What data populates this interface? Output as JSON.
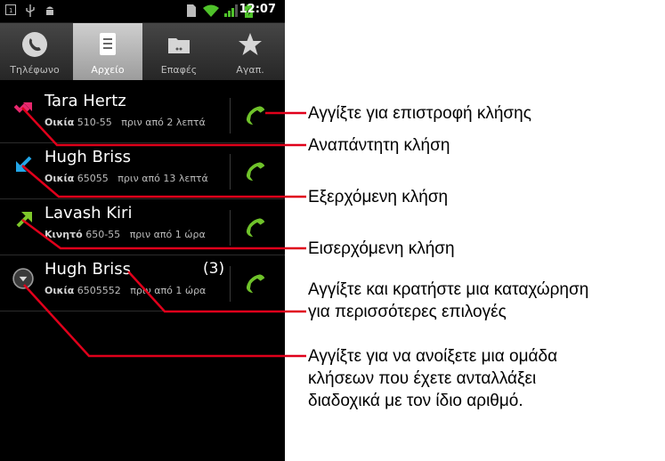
{
  "status_bar": {
    "time": "12:07",
    "icons": [
      "notification-icon",
      "usb-icon",
      "android-debug-icon",
      "sim-icon",
      "wifi-icon",
      "signal-icon",
      "battery-icon"
    ]
  },
  "tabs": [
    {
      "label": "Τηλέφωνο",
      "icon": "phone-icon",
      "selected": false
    },
    {
      "label": "Αρχείο",
      "icon": "call-log-icon",
      "selected": true
    },
    {
      "label": "Επαφές",
      "icon": "contacts-icon",
      "selected": false
    },
    {
      "label": "Αγαπ.",
      "icon": "star-icon",
      "selected": false
    }
  ],
  "call_log": [
    {
      "name": "Tara Hertz",
      "type_label": "Οικία",
      "number": "510-55",
      "time": "πριν από 2 λεπτά",
      "call_type": "missed",
      "count": ""
    },
    {
      "name": "Hugh Briss",
      "type_label": "Οικία",
      "number": "65055",
      "time": "πριν από 13 λεπτά",
      "call_type": "outgoing",
      "count": ""
    },
    {
      "name": "Lavash Kiri",
      "type_label": "Κινητό",
      "number": "650-55",
      "time": "πριν από 1 ώρα",
      "call_type": "incoming",
      "count": ""
    },
    {
      "name": "Hugh Briss",
      "type_label": "Οικία",
      "number": "6505552",
      "time": "πριν από 1 ώρα",
      "call_type": "group",
      "count": "(3)"
    }
  ],
  "annotations": {
    "callback": "Αγγίξτε για επιστροφή κλήσης",
    "missed": "Αναπάντητη κλήση",
    "outgoing": "Εξερχόμενη κλήση",
    "incoming": "Εισερχόμενη κλήση",
    "hold_line1": "Αγγίξτε και κρατήστε μια καταχώρηση",
    "hold_line2": "για περισσότερες επιλογές",
    "group_line1": "Αγγίξτε για να ανοίξετε μια ομάδα",
    "group_line2": "κλήσεων που έχετε ανταλλάξει",
    "group_line3": "διαδοχικά με τον ίδιο αριθμό."
  },
  "colors": {
    "missed": "#e8286e",
    "outgoing": "#22a6e8",
    "incoming": "#7ec82a",
    "call_button": "#6fc22a",
    "annotation_line": "#e0001b",
    "selected_tab": "#b5b5b5"
  }
}
